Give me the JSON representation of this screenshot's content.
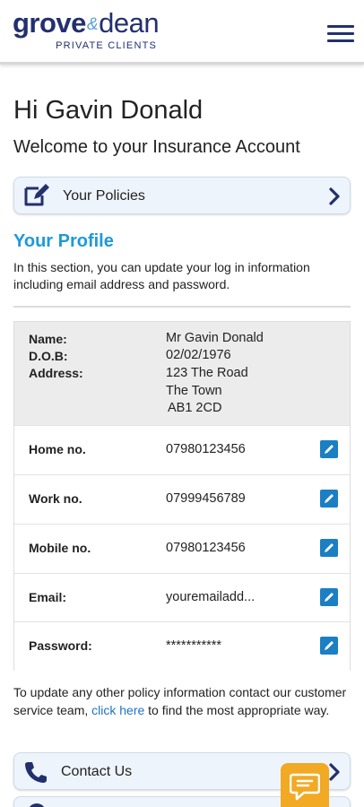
{
  "header": {
    "logo_primary": "grove",
    "logo_amp": "&",
    "logo_secondary": "dean",
    "logo_tagline": "PRIVATE CLIENTS"
  },
  "greeting": "Hi Gavin Donald",
  "welcome": "Welcome to your Insurance Account",
  "policies_link": {
    "label": "Your Policies"
  },
  "profile": {
    "title": "Your Profile",
    "description": "In this section, you can update your log in information including email address and password.",
    "name_label": "Name:",
    "name_value": "Mr Gavin Donald",
    "dob_label": "D.O.B:",
    "dob_value": "02/02/1976",
    "address_label": "Address:",
    "address_lines": [
      "123 The Road",
      "The Town",
      "AB1 2CD"
    ],
    "rows": [
      {
        "label": "Home no.",
        "value": "07980123456"
      },
      {
        "label": "Work no.",
        "value": "07999456789"
      },
      {
        "label": "Mobile no.",
        "value": "07980123456"
      },
      {
        "label": "Email:",
        "value": "youremailadd..."
      },
      {
        "label": "Password:",
        "value": "***********"
      }
    ]
  },
  "footer": {
    "text_before": "To update any other policy information contact our customer service team, ",
    "link_text": "click here",
    "text_after": " to find the most appropriate way."
  },
  "contact_link": {
    "label": "Contact Us"
  },
  "colors": {
    "brand_navy": "#23306e",
    "accent_blue": "#1e9ad6",
    "edit_blue": "#1b7fc4",
    "chat_orange": "#f2a923"
  },
  "icons": {
    "menu": "hamburger-menu-icon",
    "policies": "edit-document-icon",
    "chevron": "chevron-right-icon",
    "edit": "pencil-icon",
    "phone": "phone-icon",
    "chat": "chat-bubble-icon"
  }
}
